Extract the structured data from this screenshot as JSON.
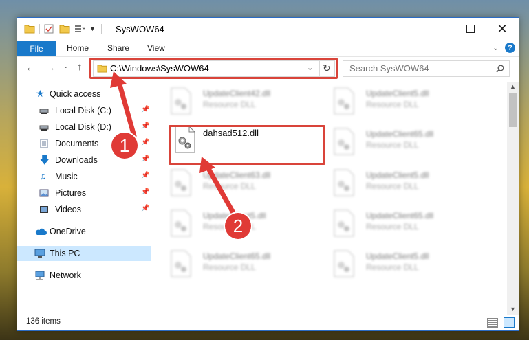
{
  "window": {
    "title": "SysWOW64"
  },
  "ribbon": {
    "tabs": [
      "File",
      "Home",
      "Share",
      "View"
    ]
  },
  "address": {
    "path": "C:\\Windows\\SysWOW64"
  },
  "search": {
    "placeholder": "Search SysWOW64"
  },
  "sidebar": {
    "items": [
      {
        "label": "Quick access",
        "icon": "star-icon"
      },
      {
        "label": "Local Disk (C:)",
        "icon": "drive-icon",
        "pinned": true
      },
      {
        "label": "Local Disk (D:)",
        "icon": "drive-icon",
        "pinned": true
      },
      {
        "label": "Documents",
        "icon": "documents-icon",
        "pinned": true
      },
      {
        "label": "Downloads",
        "icon": "download-icon",
        "pinned": true
      },
      {
        "label": "Music",
        "icon": "music-icon",
        "pinned": true
      },
      {
        "label": "Pictures",
        "icon": "pictures-icon",
        "pinned": true
      },
      {
        "label": "Videos",
        "icon": "videos-icon",
        "pinned": true
      },
      {
        "label": "OneDrive",
        "icon": "cloud-icon"
      },
      {
        "label": "This PC",
        "icon": "computer-icon",
        "selected": true
      },
      {
        "label": "Network",
        "icon": "network-icon"
      }
    ]
  },
  "files": {
    "highlighted": {
      "name": "dahsad512.dll"
    },
    "items": [
      {
        "name": "UpdateClient42.dll",
        "type": "Resource DLL"
      },
      {
        "name": "UpdateClient5.dll",
        "type": "Resource DLL"
      },
      {
        "name": "UpdateClient65.dll",
        "type": "Resource DLL"
      },
      {
        "name": "UpdateClient63.dll",
        "type": "Resource DLL"
      },
      {
        "name": "UpdateClient5.dll",
        "type": "Resource DLL"
      },
      {
        "name": "UpdateClient5.dll",
        "type": "Resource DLL"
      },
      {
        "name": "UpdateClient65.dll",
        "type": "Resource DLL"
      },
      {
        "name": "UpdateClient65.dll",
        "type": "Resource DLL"
      },
      {
        "name": "UpdateClient5.dll",
        "type": "Resource DLL"
      }
    ]
  },
  "status": {
    "item_count": "136 items"
  },
  "annotations": {
    "step1": "1",
    "step2": "2"
  },
  "colors": {
    "accent": "#1979ca",
    "highlight": "#d9443a",
    "selected_bg": "#cce8ff"
  }
}
